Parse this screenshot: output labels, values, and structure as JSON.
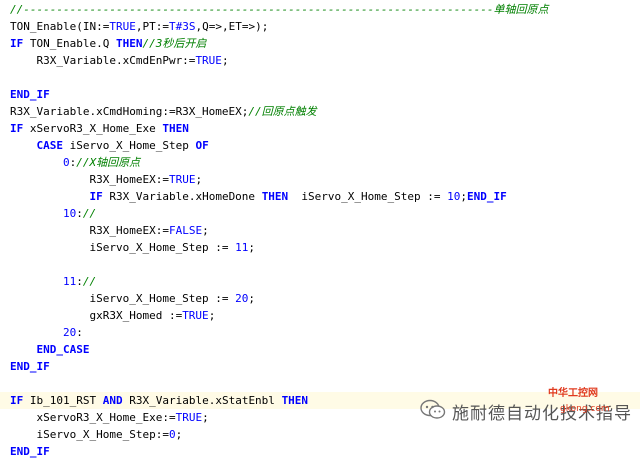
{
  "code_lines": [
    {
      "indent": 1,
      "tokens": [
        {
          "t": "//-----------------------------------------------------------------------",
          "c": "cm"
        },
        {
          "t": "单轴回原点",
          "c": "cm"
        }
      ]
    },
    {
      "indent": 1,
      "tokens": [
        {
          "t": "TON_Enable(IN:=",
          "c": "plain"
        },
        {
          "t": "TRUE",
          "c": "lit"
        },
        {
          "t": ",PT:=",
          "c": "plain"
        },
        {
          "t": "T#3S",
          "c": "lit"
        },
        {
          "t": ",Q=>,ET=>);",
          "c": "plain"
        }
      ]
    },
    {
      "indent": 1,
      "tokens": [
        {
          "t": "IF",
          "c": "kw"
        },
        {
          "t": " TON_Enable.Q ",
          "c": "plain"
        },
        {
          "t": "THEN",
          "c": "kw"
        },
        {
          "t": "//3秒后开启",
          "c": "cm"
        }
      ]
    },
    {
      "indent": 1,
      "tokens": [
        {
          "t": "    R3X_Variable.xCmdEnPwr:=",
          "c": "plain"
        },
        {
          "t": "TRUE",
          "c": "lit"
        },
        {
          "t": ";",
          "c": "plain"
        }
      ]
    },
    {
      "indent": 1,
      "tokens": []
    },
    {
      "indent": 1,
      "tokens": [
        {
          "t": "END_IF",
          "c": "kw"
        }
      ]
    },
    {
      "indent": 1,
      "tokens": [
        {
          "t": "R3X_Variable.xCmdHoming:=R3X_HomeEX;",
          "c": "plain"
        },
        {
          "t": "//回原点触发",
          "c": "cm"
        }
      ]
    },
    {
      "indent": 1,
      "tokens": [
        {
          "t": "IF",
          "c": "kw"
        },
        {
          "t": " xServoR3_X_Home_Exe ",
          "c": "plain"
        },
        {
          "t": "THEN",
          "c": "kw"
        }
      ]
    },
    {
      "indent": 1,
      "tokens": [
        {
          "t": "    ",
          "c": "plain"
        },
        {
          "t": "CASE",
          "c": "kw"
        },
        {
          "t": " iServo_X_Home_Step ",
          "c": "plain"
        },
        {
          "t": "OF",
          "c": "kw"
        }
      ]
    },
    {
      "indent": 1,
      "tokens": [
        {
          "t": "        ",
          "c": "plain"
        },
        {
          "t": "0",
          "c": "num"
        },
        {
          "t": ":",
          "c": "plain"
        },
        {
          "t": "//X轴回原点",
          "c": "cm"
        }
      ]
    },
    {
      "indent": 1,
      "tokens": [
        {
          "t": "            R3X_HomeEX:=",
          "c": "plain"
        },
        {
          "t": "TRUE",
          "c": "lit"
        },
        {
          "t": ";",
          "c": "plain"
        }
      ]
    },
    {
      "indent": 1,
      "tokens": [
        {
          "t": "            ",
          "c": "plain"
        },
        {
          "t": "IF",
          "c": "kw"
        },
        {
          "t": " R3X_Variable.xHomeDone ",
          "c": "plain"
        },
        {
          "t": "THEN",
          "c": "kw"
        },
        {
          "t": "  iServo_X_Home_Step := ",
          "c": "plain"
        },
        {
          "t": "10",
          "c": "num"
        },
        {
          "t": ";",
          "c": "plain"
        },
        {
          "t": "END_IF",
          "c": "kw"
        }
      ]
    },
    {
      "indent": 1,
      "tokens": [
        {
          "t": "        ",
          "c": "plain"
        },
        {
          "t": "10",
          "c": "num"
        },
        {
          "t": ":",
          "c": "plain"
        },
        {
          "t": "//",
          "c": "cm"
        }
      ]
    },
    {
      "indent": 1,
      "tokens": [
        {
          "t": "            R3X_HomeEX:=",
          "c": "plain"
        },
        {
          "t": "FALSE",
          "c": "lit"
        },
        {
          "t": ";",
          "c": "plain"
        }
      ]
    },
    {
      "indent": 1,
      "tokens": [
        {
          "t": "            iServo_X_Home_Step := ",
          "c": "plain"
        },
        {
          "t": "11",
          "c": "num"
        },
        {
          "t": ";",
          "c": "plain"
        }
      ]
    },
    {
      "indent": 1,
      "tokens": []
    },
    {
      "indent": 1,
      "tokens": [
        {
          "t": "        ",
          "c": "plain"
        },
        {
          "t": "11",
          "c": "num"
        },
        {
          "t": ":",
          "c": "plain"
        },
        {
          "t": "//",
          "c": "cm"
        }
      ]
    },
    {
      "indent": 1,
      "tokens": [
        {
          "t": "            iServo_X_Home_Step := ",
          "c": "plain"
        },
        {
          "t": "20",
          "c": "num"
        },
        {
          "t": ";",
          "c": "plain"
        }
      ]
    },
    {
      "indent": 1,
      "tokens": [
        {
          "t": "            gxR3X_Homed :=",
          "c": "plain"
        },
        {
          "t": "TRUE",
          "c": "lit"
        },
        {
          "t": ";",
          "c": "plain"
        }
      ]
    },
    {
      "indent": 1,
      "tokens": [
        {
          "t": "        ",
          "c": "plain"
        },
        {
          "t": "20",
          "c": "num"
        },
        {
          "t": ":",
          "c": "plain"
        }
      ]
    },
    {
      "indent": 1,
      "tokens": [
        {
          "t": "    ",
          "c": "plain"
        },
        {
          "t": "END_CASE",
          "c": "kw"
        }
      ]
    },
    {
      "indent": 1,
      "tokens": [
        {
          "t": "END_IF",
          "c": "kw"
        }
      ]
    },
    {
      "indent": 1,
      "tokens": []
    },
    {
      "indent": 1,
      "hl": true,
      "tokens": [
        {
          "t": "IF",
          "c": "kw"
        },
        {
          "t": " Ib_101_RST ",
          "c": "plain"
        },
        {
          "t": "AND",
          "c": "kw"
        },
        {
          "t": " R3X_Variable.xStatEnbl ",
          "c": "plain"
        },
        {
          "t": "THEN",
          "c": "kw"
        }
      ]
    },
    {
      "indent": 1,
      "tokens": [
        {
          "t": "    xServoR3_X_Home_Exe:=",
          "c": "plain"
        },
        {
          "t": "TRUE",
          "c": "lit"
        },
        {
          "t": ";",
          "c": "plain"
        }
      ]
    },
    {
      "indent": 1,
      "tokens": [
        {
          "t": "    iServo_X_Home_Step:=",
          "c": "plain"
        },
        {
          "t": "0",
          "c": "num"
        },
        {
          "t": ";",
          "c": "plain"
        }
      ]
    },
    {
      "indent": 1,
      "tokens": [
        {
          "t": "END_IF",
          "c": "kw"
        }
      ]
    }
  ],
  "watermark": {
    "text": "施耐德自动化技术指导",
    "brand": "中华工控网",
    "url": "gkong.com",
    "icon": "wechat-icon"
  }
}
